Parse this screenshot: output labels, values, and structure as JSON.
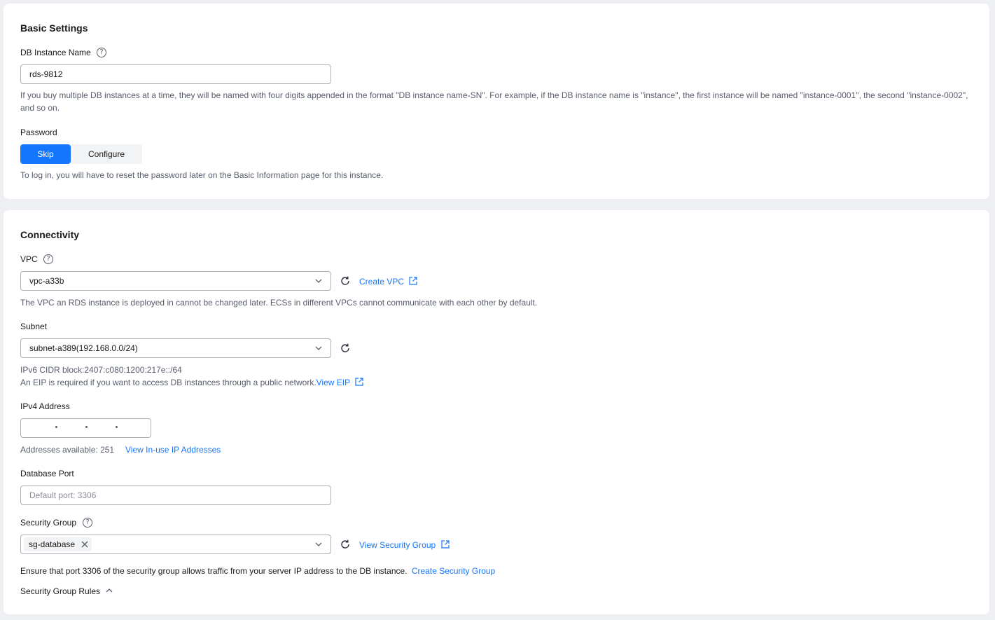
{
  "basic": {
    "title": "Basic Settings",
    "instance_name_label": "DB Instance Name",
    "instance_name_value": "rds-9812",
    "instance_name_hint": "If you buy multiple DB instances at a time, they will be named with four digits appended in the format \"DB instance name-SN\". For example, if the DB instance name is \"instance\", the first instance will be named \"instance-0001\", the second \"instance-0002\", and so on.",
    "password_label": "Password",
    "password_options": [
      "Skip",
      "Configure"
    ],
    "password_selected": "Skip",
    "password_hint": "To log in, you will have to reset the password later on the Basic Information page for this instance."
  },
  "connectivity": {
    "title": "Connectivity",
    "vpc_label": "VPC",
    "vpc_value": "vpc-a33b",
    "create_vpc_link": "Create VPC",
    "vpc_hint": "The VPC an RDS instance is deployed in cannot be changed later. ECSs in different VPCs cannot communicate with each other by default.",
    "subnet_label": "Subnet",
    "subnet_value": "subnet-a389(192.168.0.0/24)",
    "ipv6_hint": "IPv6 CIDR block:2407:c080:1200:217e::/64",
    "eip_hint": "An EIP is required if you want to access DB instances through a public network.",
    "view_eip_link": "View EIP",
    "ipv4_label": "IPv4 Address",
    "addresses_available": "Addresses available: 251",
    "view_inuse_link": "View In-use IP Addresses",
    "port_label": "Database Port",
    "port_placeholder": "Default port: 3306",
    "sg_label": "Security Group",
    "sg_tag": "sg-database",
    "view_sg_link": "View Security Group",
    "sg_hint": "Ensure that port 3306 of the security group allows traffic from your server IP address to the DB instance.",
    "create_sg_link": "Create Security Group",
    "sg_rules_label": "Security Group Rules"
  },
  "colors": {
    "accent": "#1476ff",
    "page_bg": "#eff0f3",
    "card_bg": "#ffffff"
  },
  "icons": [
    "help-icon",
    "chevron-down-icon",
    "refresh-icon",
    "external-link-icon",
    "close-icon",
    "chevron-up-icon"
  ]
}
